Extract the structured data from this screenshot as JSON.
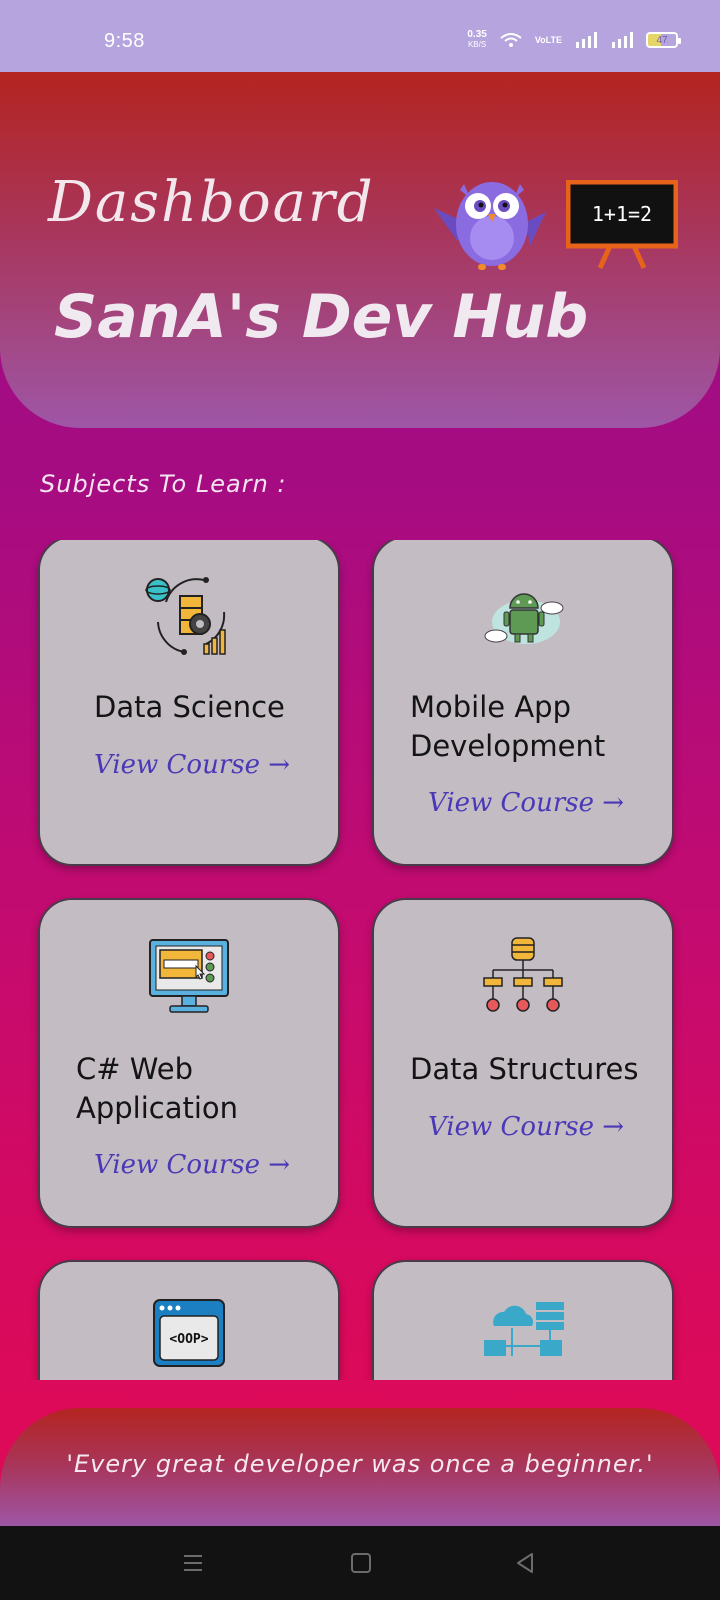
{
  "status_bar": {
    "time": "9:58",
    "net_speed_value": "0.35",
    "net_speed_unit": "KB/S",
    "volte": "VoLTE",
    "battery": "47"
  },
  "header": {
    "title": "Dashboard",
    "subtitle": "SanA's Dev Hub",
    "board_text": "1+1=2"
  },
  "section_label": "Subjects To Learn :",
  "courses": [
    {
      "title": "Data Science",
      "link": "View Course →",
      "icon": "data-science-icon"
    },
    {
      "title": "Mobile App Development",
      "link": "View Course →",
      "icon": "android-cloud-icon"
    },
    {
      "title": "C# Web Application",
      "link": "View Course →",
      "icon": "web-monitor-icon"
    },
    {
      "title": "Data Structures",
      "link": "View Course →",
      "icon": "hierarchy-tree-icon"
    },
    {
      "title": "",
      "link": "",
      "icon": "oop-code-icon"
    },
    {
      "title": "",
      "link": "",
      "icon": "network-cloud-icon"
    }
  ],
  "quote": "'Every great developer was once a beginner.'",
  "colors": {
    "status_bar": "#b5a4dd",
    "card_bg": "#c3bdc3",
    "link": "#4a38b7",
    "header_top": "#b42420"
  }
}
